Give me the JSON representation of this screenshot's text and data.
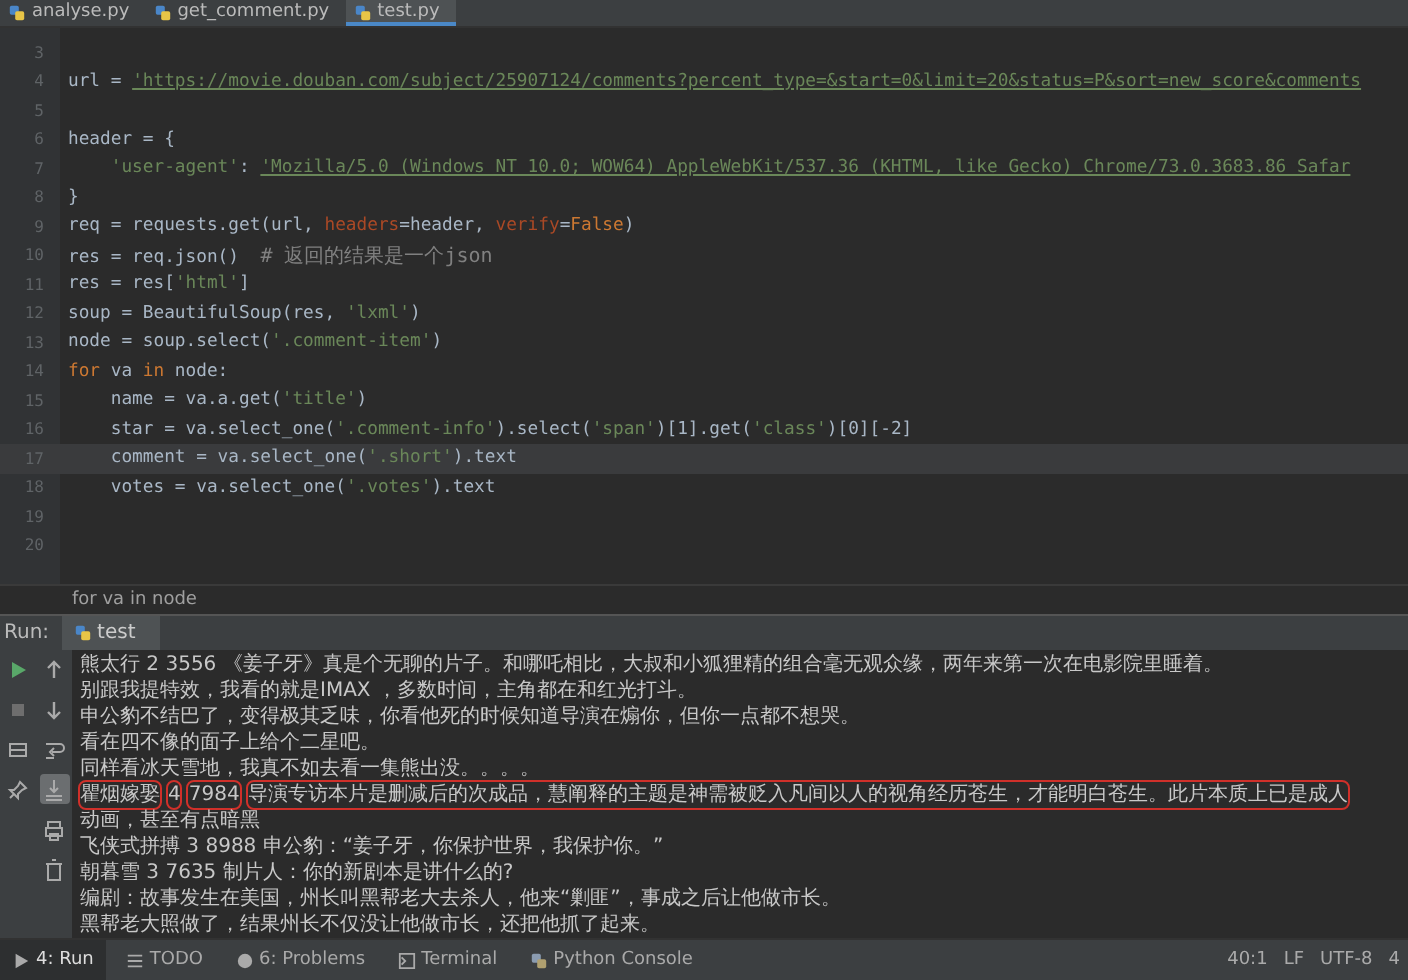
{
  "file_tabs": [
    {
      "label": "analyse.py",
      "selected": false
    },
    {
      "label": "get_comment.py",
      "selected": false
    },
    {
      "label": "test.py",
      "selected": true
    }
  ],
  "editor": {
    "lines": [
      {
        "number": "3",
        "current": false
      },
      {
        "number": "4",
        "current": false,
        "tokens": [
          {
            "kind": "plain",
            "text": "url = "
          },
          {
            "kind": "link",
            "text": "'https://movie.douban.com/subject/25907124/comments?percent_type=&start=0&limit=20&status=P&sort=new_score&comments"
          }
        ]
      },
      {
        "number": "5",
        "current": false
      },
      {
        "number": "6",
        "current": false,
        "tokens": [
          {
            "kind": "plain",
            "text": "header = {"
          }
        ]
      },
      {
        "number": "7",
        "current": false,
        "tokens": [
          {
            "kind": "string",
            "text": "    'user-agent'"
          },
          {
            "kind": "plain",
            "text": ": "
          },
          {
            "kind": "link",
            "text": "'Mozilla/5.0 (Windows NT 10.0; WOW64) AppleWebKit/537.36 (KHTML, like Gecko) Chrome/73.0.3683.86 Safar"
          }
        ]
      },
      {
        "number": "8",
        "current": false,
        "tokens": [
          {
            "kind": "plain",
            "text": "}"
          }
        ]
      },
      {
        "number": "9",
        "current": false,
        "tokens": [
          {
            "kind": "plain",
            "text": "req = requests.get(url, "
          },
          {
            "kind": "param",
            "text": "headers"
          },
          {
            "kind": "plain",
            "text": "=header, "
          },
          {
            "kind": "param",
            "text": "verify"
          },
          {
            "kind": "plain",
            "text": "="
          },
          {
            "kind": "keyword",
            "text": "False"
          },
          {
            "kind": "plain",
            "text": ")"
          }
        ]
      },
      {
        "number": "10",
        "current": false,
        "tokens": [
          {
            "kind": "plain",
            "text": "res = req.json()  "
          },
          {
            "kind": "comment",
            "text": "# 返回的结果是一个json"
          }
        ]
      },
      {
        "number": "11",
        "current": false,
        "tokens": [
          {
            "kind": "plain",
            "text": "res = res["
          },
          {
            "kind": "string",
            "text": "'html'"
          },
          {
            "kind": "plain",
            "text": "]"
          }
        ]
      },
      {
        "number": "12",
        "current": false,
        "tokens": [
          {
            "kind": "plain",
            "text": "soup = BeautifulSoup(res, "
          },
          {
            "kind": "string",
            "text": "'lxml'"
          },
          {
            "kind": "plain",
            "text": ")"
          }
        ]
      },
      {
        "number": "13",
        "current": false,
        "tokens": [
          {
            "kind": "plain",
            "text": "node = soup.select("
          },
          {
            "kind": "string",
            "text": "'.comment-item'"
          },
          {
            "kind": "plain",
            "text": ")"
          }
        ]
      },
      {
        "number": "14",
        "current": false,
        "tokens": [
          {
            "kind": "keyword",
            "text": "for"
          },
          {
            "kind": "plain",
            "text": " va "
          },
          {
            "kind": "keyword",
            "text": "in"
          },
          {
            "kind": "plain",
            "text": " node:"
          }
        ]
      },
      {
        "number": "15",
        "current": false,
        "tokens": [
          {
            "kind": "plain",
            "text": "    name = va.a.get("
          },
          {
            "kind": "string",
            "text": "'title'"
          },
          {
            "kind": "plain",
            "text": ")"
          }
        ]
      },
      {
        "number": "16",
        "current": false,
        "tokens": [
          {
            "kind": "plain",
            "text": "    star = va.select_one("
          },
          {
            "kind": "string",
            "text": "'.comment-info'"
          },
          {
            "kind": "plain",
            "text": ").select("
          },
          {
            "kind": "string",
            "text": "'span'"
          },
          {
            "kind": "plain",
            "text": ")[1].get("
          },
          {
            "kind": "string",
            "text": "'class'"
          },
          {
            "kind": "plain",
            "text": ")[0][-2]"
          }
        ]
      },
      {
        "number": "17",
        "current": true,
        "tokens": [
          {
            "kind": "plain",
            "text": "    comment = va.select_one("
          },
          {
            "kind": "string",
            "text": "'.short'"
          },
          {
            "kind": "plain",
            "text": ").text"
          }
        ]
      },
      {
        "number": "18",
        "current": false,
        "tokens": [
          {
            "kind": "plain",
            "text": "    votes = va.select_one("
          },
          {
            "kind": "string",
            "text": "'.votes'"
          },
          {
            "kind": "plain",
            "text": ").text"
          }
        ]
      },
      {
        "number": "19",
        "current": false
      },
      {
        "number": "20",
        "current": false
      }
    ],
    "breadcrumb": "for va in node"
  },
  "run": {
    "label": "Run:",
    "tab": "test",
    "left_tools": [
      {
        "kind": "play",
        "selected": false
      },
      {
        "kind": "stop",
        "selected": false
      },
      {
        "kind": "layout",
        "selected": false
      },
      {
        "kind": "pin",
        "selected": false
      }
    ],
    "right_tools": [
      {
        "kind": "up",
        "selected": false
      },
      {
        "kind": "down",
        "selected": false
      },
      {
        "kind": "wrap",
        "selected": false
      },
      {
        "kind": "scroll",
        "selected": true
      },
      {
        "kind": "print",
        "selected": false
      },
      {
        "kind": "trash",
        "selected": false
      }
    ],
    "output": [
      {
        "segments": [
          {
            "text": "熊太行 2 3556 《姜子牙》真是个无聊的片子。和哪吒相比，大叔和小狐狸精的组合毫无观众缘，两年来第一次在电影院里睡着。",
            "boxed": false
          }
        ]
      },
      {
        "segments": [
          {
            "text": "别跟我提特效，我看的就是IMAX ，多数时间，主角都在和红光打斗。",
            "boxed": false
          }
        ]
      },
      {
        "segments": [
          {
            "text": "申公豹不结巴了，变得极其乏味，你看他死的时候知道导演在煽你，但你一点都不想哭。",
            "boxed": false
          }
        ]
      },
      {
        "segments": [
          {
            "text": "看在四不像的面子上给个二星吧。",
            "boxed": false
          }
        ]
      },
      {
        "segments": [
          {
            "text": "同样看冰天雪地，我真不如去看一集熊出没。。。。",
            "boxed": false
          }
        ]
      },
      {
        "segments": [
          {
            "text": "瞿烟嫁娶",
            "boxed": true
          },
          {
            "text": "4",
            "boxed": true
          },
          {
            "text": "7984",
            "boxed": true
          },
          {
            "text": "导演专访本片是删减后的次成品，慧阐释的主题是神需被贬入凡间以人的视角经历苍生，才能明白苍生。此片本质上已是成人",
            "boxed": true
          },
          {
            "text": "动画，甚至有点暗黑",
            "boxed": false
          }
        ]
      },
      {
        "segments": [
          {
            "text": "飞侠式拼搏 3 8988 申公豹：“姜子牙，你保护世界，我保护你。”",
            "boxed": false
          }
        ]
      },
      {
        "segments": [
          {
            "text": "朝暮雪 3 7635 制片人：你的新剧本是讲什么的?",
            "boxed": false
          }
        ]
      },
      {
        "segments": [
          {
            "text": "编剧：故事发生在美国，州长叫黑帮老大去杀人，他来“剿匪”，事成之后让他做市长。",
            "boxed": false
          }
        ]
      },
      {
        "segments": [
          {
            "text": "黑帮老大照做了，结果州长不仅没让他做市长，还把他抓了起来。",
            "boxed": false
          }
        ]
      }
    ]
  },
  "tool_tabs": [
    {
      "kind": "run",
      "label": "4: Run",
      "selected": true
    },
    {
      "kind": "todo",
      "label": "TODO",
      "selected": false
    },
    {
      "kind": "problems",
      "label": "6: Problems",
      "selected": false
    },
    {
      "kind": "terminal",
      "label": "Terminal",
      "selected": false
    },
    {
      "kind": "python",
      "label": "Python Console",
      "selected": false
    }
  ],
  "status_bar": [
    "40:1",
    "LF",
    "UTF-8",
    "4"
  ]
}
